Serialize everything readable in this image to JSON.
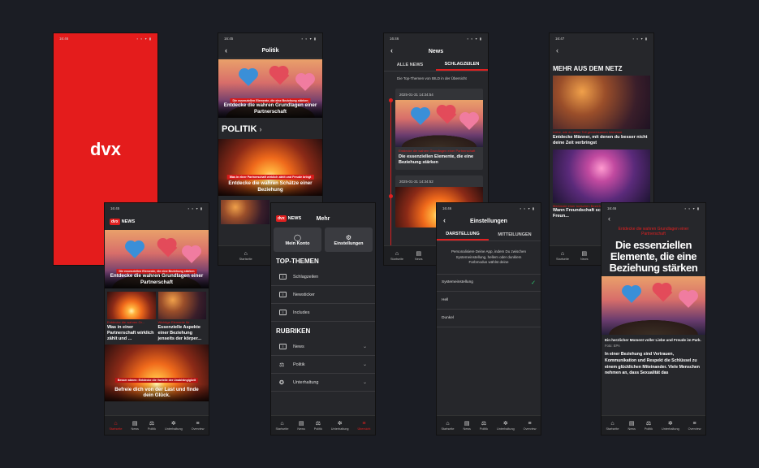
{
  "accent": "#e02020",
  "splash": {
    "time": "16:46",
    "logo": "dvx"
  },
  "home": {
    "time": "16:45",
    "logo_badge": "dvx",
    "logo_text": "NEWS",
    "hero_tag": "Die essenziellen Elemente, die eine Beziehung stärken",
    "hero_title": "Entdecke die wahren Grundlagen einer Partnerschaft",
    "card1_kicker": "Entdecke die wahren Gr...",
    "card1_title": "Was in einer Partnerschaft wirklich zählt und ...",
    "card2_kicker": "Wichtige Elemente für ...",
    "card2_title": "Essenzielle Aspekte einer Beziehung jenseits der körper...",
    "big_tag": "Besser atmen: Entdecke die Vorteile der Unabhängigkeit",
    "big_title": "Befreie dich von der Last und finde dein Glück."
  },
  "politik": {
    "time": "16:45",
    "title": "Politik",
    "hero_tag": "Die essenziellen Elemente, die eine Beziehung stärken",
    "hero_title": "Entdecke die wahren Grundlagen einer Partnerschaft",
    "section": "POLITIK",
    "card_tag": "Was in einer Partnerschaft wirklich zählt und Freude bringt",
    "card_title": "Entdecke die wahren Schätze einer Beziehung",
    "small_kicker": "Wichtige Elemente für di..."
  },
  "mehr": {
    "logo_badge": "dvx",
    "logo_text": "NEWS",
    "title": "Mehr",
    "btn_account": "Mein Konto",
    "btn_settings": "Einstellungen",
    "sec_top": "TOP-THEMEN",
    "top": [
      "Schlagzeilen",
      "Newsticker",
      "Includes"
    ],
    "sec_rubriken": "RUBRIKEN",
    "rubriken": [
      "News",
      "Politik",
      "Unterhaltung"
    ]
  },
  "news": {
    "time": "16:46",
    "title": "News",
    "tab1": "ALLE NEWS",
    "tab2": "SCHLAGZEILEN",
    "sub": "Die Top-Themen von BILD in der Übersicht",
    "t1": "2025-01-31 14:34:54",
    "kicker1": "Entdecke die wahren Grundlagen einer Partnerschaft",
    "title1": "Die essenziellen Elemente, die eine Beziehung stärken",
    "t2": "2025-01-31 14:34:52"
  },
  "settings": {
    "time": "16:46",
    "title": "Einstellungen",
    "tab1": "DARSTELLUNG",
    "tab2": "MITTEILUNGEN",
    "desc": "Personalisiere Deine App, indem Du zwischen Systemeinstellung, hellem oder dunklem Farbmodus wählst deine",
    "opt1": "Systemeinstellung",
    "opt2": "Hell",
    "opt3": "Dunkel",
    "check": "✓"
  },
  "netz": {
    "time": "16:47",
    "section": "MEHR AUS DEM NETZ",
    "kicker1": "Liebe, wie du deine Teil gemeinsamen Interesse",
    "title1": "Entdecke Männer, mit denen du besser nicht deine Zeit verbringst",
    "kicker2": "Merkmale einer toxischen Beziehung",
    "title2": "Wann Freundschaft sc... Arten toxischer Freun..."
  },
  "article": {
    "time": "16:46",
    "kicker": "Entdecke die wahren Grundlagen einer Partnerschaft",
    "headline": "Die essenziellen Elemente, die eine Beziehung stärken",
    "img_caption": "Ein herzlicher Moment voller Liebe und Freude im Park.",
    "credit": "Foto: EPA",
    "body": "In einer Beziehung sind Vertrauen, Kommunikation und Respekt die Schlüssel zu einem glücklichen Miteinander. Viele Menschen nehmen an, dass Sexualität das"
  },
  "nav": [
    "Startseite",
    "News",
    "Politik",
    "Unterhaltung",
    "Overview"
  ],
  "nav_mehr_last": "Übersicht"
}
